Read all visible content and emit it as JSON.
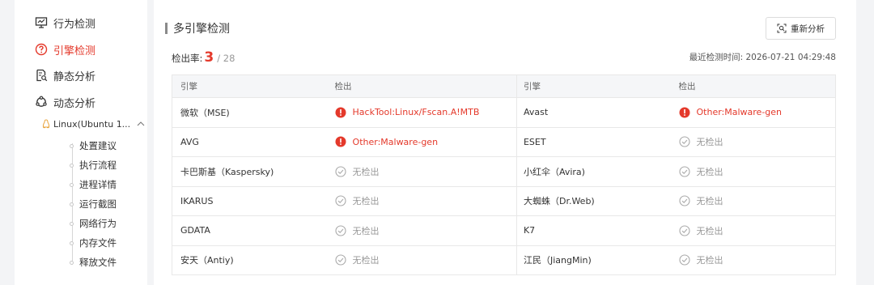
{
  "sidebar": {
    "items": [
      {
        "label": "行为检测",
        "icon": "monitor-icon",
        "active": false
      },
      {
        "label": "引擎检测",
        "icon": "help-circle-icon",
        "active": true
      },
      {
        "label": "静态分析",
        "icon": "document-search-icon",
        "active": false
      },
      {
        "label": "动态分析",
        "icon": "cycle-icon",
        "active": false
      }
    ],
    "os_item": {
      "label": "Linux(Ubuntu 1...",
      "icon": "linux-icon",
      "expand_icon": "chevron-up-icon"
    },
    "sub_items": [
      "处置建议",
      "执行流程",
      "进程详情",
      "运行截图",
      "网络行为",
      "内存文件",
      "释放文件"
    ]
  },
  "main": {
    "title": "多引擎检测",
    "reanalyze_label": "重新分析",
    "rate_label": "检出率:",
    "rate_detected": "3",
    "rate_total": "/ 28",
    "last_time_label": "最近检测时间: 2026-07-21 04:29:48",
    "table": {
      "headers": [
        "引擎",
        "检出",
        "引擎",
        "检出"
      ],
      "rows": [
        {
          "left": {
            "engine": "微软（MSE)",
            "result": "HackTool:Linux/Fscan.A!MTB",
            "detected": true
          },
          "right": {
            "engine": "Avast",
            "result": "Other:Malware-gen",
            "detected": true
          }
        },
        {
          "left": {
            "engine": "AVG",
            "result": "Other:Malware-gen",
            "detected": true
          },
          "right": {
            "engine": "ESET",
            "result": "无检出",
            "detected": false
          }
        },
        {
          "left": {
            "engine": "卡巴斯基（Kaspersky)",
            "result": "无检出",
            "detected": false
          },
          "right": {
            "engine": "小红伞（Avira)",
            "result": "无检出",
            "detected": false
          }
        },
        {
          "left": {
            "engine": "IKARUS",
            "result": "无检出",
            "detected": false
          },
          "right": {
            "engine": "大蜘蛛（Dr.Web)",
            "result": "无检出",
            "detected": false
          }
        },
        {
          "left": {
            "engine": "GDATA",
            "result": "无检出",
            "detected": false
          },
          "right": {
            "engine": "K7",
            "result": "无检出",
            "detected": false
          }
        },
        {
          "left": {
            "engine": "安天（Antiy)",
            "result": "无检出",
            "detected": false
          },
          "right": {
            "engine": "江民（JiangMin)",
            "result": "无检出",
            "detected": false
          }
        }
      ]
    }
  },
  "colors": {
    "accent": "#e4392b",
    "muted": "#999999"
  }
}
